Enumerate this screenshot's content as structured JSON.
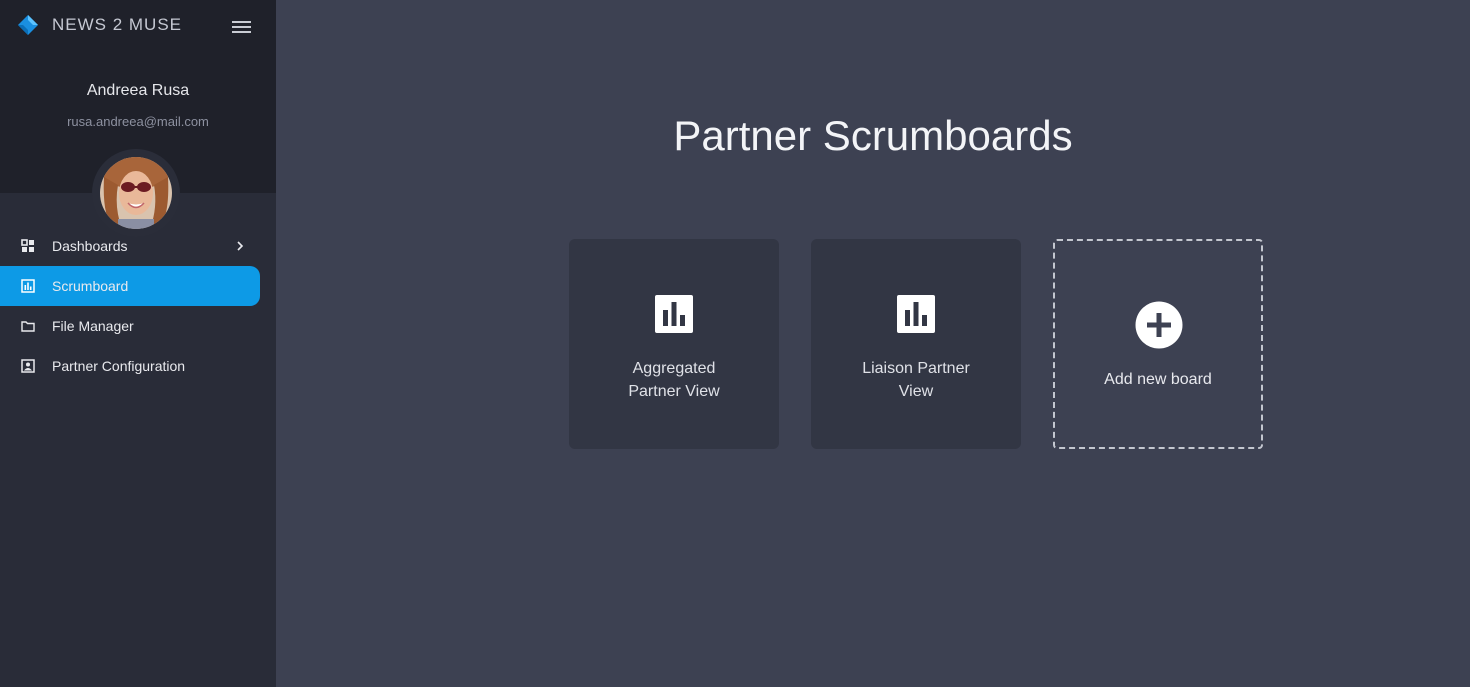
{
  "app": {
    "brand": "NEWS 2 MUSE"
  },
  "user": {
    "name": "Andreea Rusa",
    "email": "rusa.andreea@mail.com"
  },
  "nav": {
    "items": [
      {
        "label": "Dashboards",
        "icon": "grid-icon",
        "has_submenu": true,
        "active": false
      },
      {
        "label": "Scrumboard",
        "icon": "chart-icon",
        "active": true
      },
      {
        "label": "File Manager",
        "icon": "folder-icon",
        "active": false
      },
      {
        "label": "Partner Configuration",
        "icon": "contact-icon",
        "active": false
      }
    ]
  },
  "main": {
    "title": "Partner Scrumboards",
    "boards": [
      {
        "label": "Aggregated\nPartner View",
        "icon": "bar-chart-icon"
      },
      {
        "label": "Liaison Partner\nView",
        "icon": "bar-chart-icon"
      }
    ],
    "add_board_label": "Add new board"
  },
  "colors": {
    "accent": "#0d9ae6",
    "sidebar": "#292c38",
    "sidebar_header": "#1f212a",
    "content_bg": "#3d4152",
    "card_bg": "#323644"
  }
}
